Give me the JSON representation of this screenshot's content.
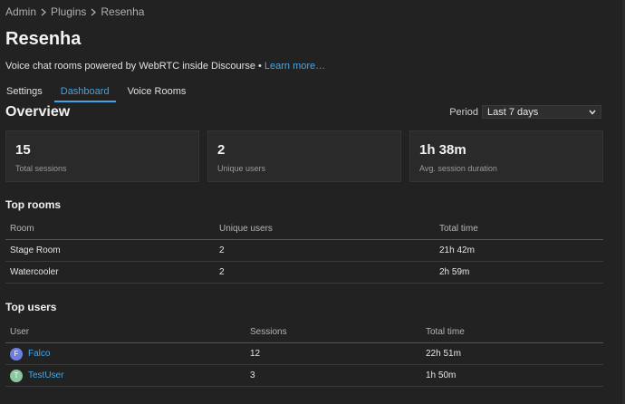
{
  "breadcrumb": {
    "items": [
      "Admin",
      "Plugins",
      "Resenha"
    ]
  },
  "page": {
    "title": "Resenha",
    "description": "Voice chat rooms powered by WebRTC inside Discourse • ",
    "learn_more": "Learn more…"
  },
  "tabs": [
    {
      "label": "Settings",
      "active": false
    },
    {
      "label": "Dashboard",
      "active": true
    },
    {
      "label": "Voice Rooms",
      "active": false
    }
  ],
  "overview": {
    "title": "Overview",
    "period_label": "Period",
    "period_value": "Last 7 days",
    "stats": [
      {
        "value": "15",
        "label": "Total sessions"
      },
      {
        "value": "2",
        "label": "Unique users"
      },
      {
        "value": "1h 38m",
        "label": "Avg. session duration"
      }
    ]
  },
  "top_rooms": {
    "title": "Top rooms",
    "headers": [
      "Room",
      "Unique users",
      "Total time"
    ],
    "rows": [
      [
        "Stage Room",
        "2",
        "21h 42m"
      ],
      [
        "Watercooler",
        "2",
        "2h 59m"
      ]
    ]
  },
  "top_users": {
    "title": "Top users",
    "headers": [
      "User",
      "Sessions",
      "Total time"
    ],
    "rows": [
      {
        "initial": "F",
        "avatar_color": "#6e7fe0",
        "name": "Falco",
        "sessions": "12",
        "total": "22h 51m"
      },
      {
        "initial": "T",
        "avatar_color": "#8bc7a1",
        "name": "TestUser",
        "sessions": "3",
        "total": "1h 50m"
      }
    ]
  },
  "colors": {
    "accent": "#3fa4e8",
    "link": "#46a6e8",
    "background": "#222222"
  },
  "icons": {
    "breadcrumb_separator": "chevron-right-icon",
    "dropdown": "chevron-down-icon"
  }
}
